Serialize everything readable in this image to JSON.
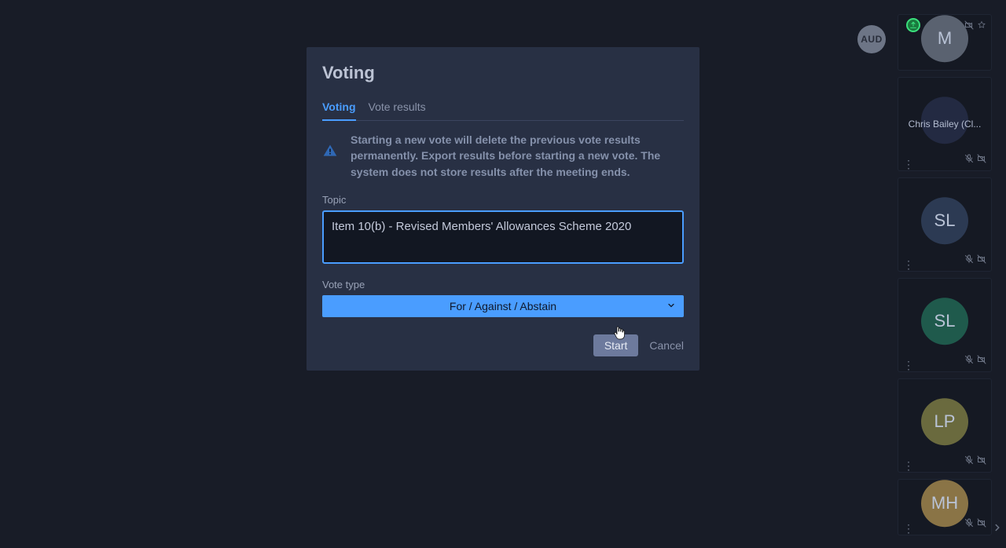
{
  "aud_label": "AUD",
  "modal": {
    "title": "Voting",
    "tabs": {
      "voting": "Voting",
      "results": "Vote results"
    },
    "warning": "Starting a new vote will delete the previous vote results permanently. Export results before starting a new vote. The system does not store results after the meeting ends.",
    "topic_label": "Topic",
    "topic_value": "Item 10(b) - Revised Members' Allowances Scheme 2020",
    "vote_type_label": "Vote type",
    "vote_type_value": "For / Against / Abstain",
    "start_label": "Start",
    "cancel_label": "Cancel"
  },
  "participants": [
    {
      "initials": "M",
      "color": "#5a6270",
      "name": "",
      "sharing": true,
      "mic_muted": false,
      "cam_off": true,
      "starred": true,
      "tall": false
    },
    {
      "initials": "",
      "color": "#232a42",
      "name": "Chris Bailey (Cl...",
      "sharing": false,
      "mic_muted": true,
      "cam_off": true,
      "starred": false,
      "tall": true
    },
    {
      "initials": "SL",
      "color": "#2c3a53",
      "name": "",
      "sharing": false,
      "mic_muted": true,
      "cam_off": true,
      "starred": false,
      "tall": true
    },
    {
      "initials": "SL",
      "color": "#1f5a4c",
      "name": "",
      "sharing": false,
      "mic_muted": true,
      "cam_off": true,
      "starred": false,
      "tall": true
    },
    {
      "initials": "LP",
      "color": "#6a6a3e",
      "name": "",
      "sharing": false,
      "mic_muted": true,
      "cam_off": true,
      "starred": false,
      "tall": true
    },
    {
      "initials": "MH",
      "color": "#8a7446",
      "name": "",
      "sharing": false,
      "mic_muted": true,
      "cam_off": true,
      "starred": false,
      "tall": false
    }
  ]
}
